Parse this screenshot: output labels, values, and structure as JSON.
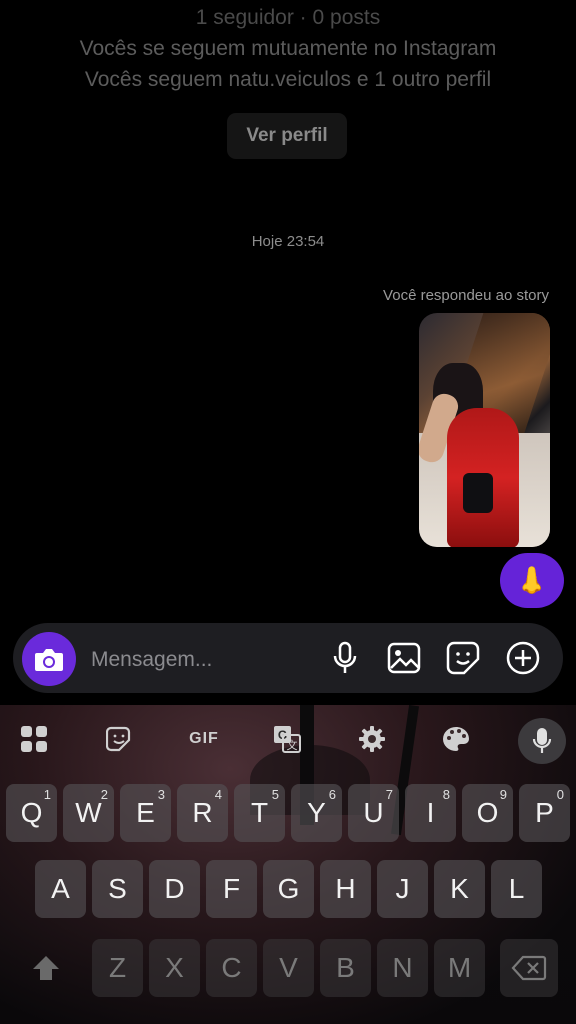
{
  "profile": {
    "followers_posts": "1 seguidor · 0 posts",
    "mutual_follow": "Vocês se seguem mutuamente no Instagram",
    "you_follow": "Vocês seguem natu.veiculos e 1 outro perfil",
    "view_profile_label": "Ver perfil"
  },
  "chat": {
    "timestamp": "Hoje 23:54",
    "story_reply_label": "Você respondeu ao story",
    "reaction_emoji": "👃"
  },
  "composer": {
    "placeholder": "Mensagem...",
    "icons": [
      "camera-icon",
      "microphone-icon",
      "image-icon",
      "sticker-icon",
      "add-icon"
    ],
    "accent_color": "#6a2adb"
  },
  "keyboard": {
    "toolbar": {
      "icons": [
        "apps-grid-icon",
        "sticker-icon",
        "gif-icon",
        "translate-icon",
        "settings-icon",
        "palette-icon",
        "microphone-icon"
      ],
      "gif_label": "GIF"
    },
    "row1": [
      {
        "key": "Q",
        "hint": "1"
      },
      {
        "key": "W",
        "hint": "2"
      },
      {
        "key": "E",
        "hint": "3"
      },
      {
        "key": "R",
        "hint": "4"
      },
      {
        "key": "T",
        "hint": "5"
      },
      {
        "key": "Y",
        "hint": "6"
      },
      {
        "key": "U",
        "hint": "7"
      },
      {
        "key": "I",
        "hint": "8"
      },
      {
        "key": "O",
        "hint": "9"
      },
      {
        "key": "P",
        "hint": "0"
      }
    ],
    "row2": [
      "A",
      "S",
      "D",
      "F",
      "G",
      "H",
      "J",
      "K",
      "L"
    ],
    "row3": [
      "Z",
      "X",
      "C",
      "V",
      "B",
      "N",
      "M"
    ]
  }
}
